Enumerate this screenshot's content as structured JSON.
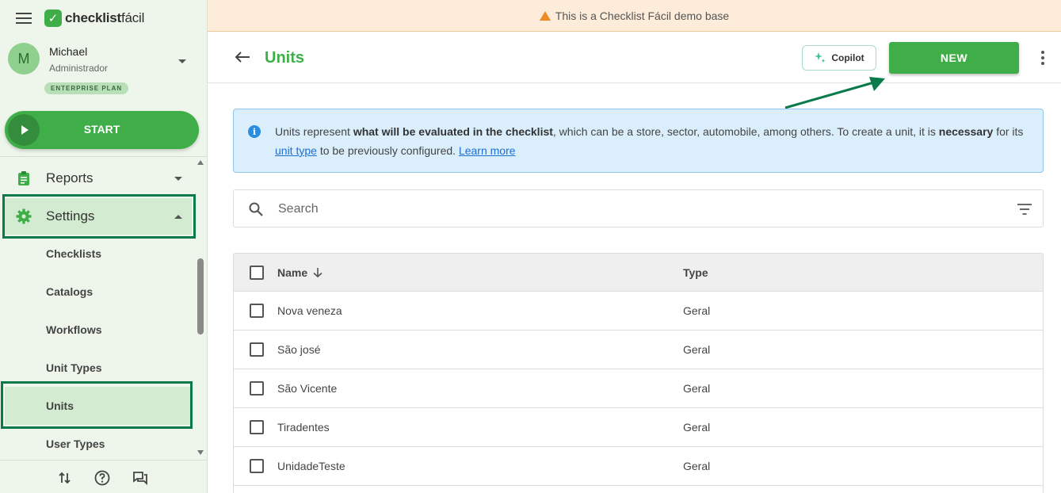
{
  "app": {
    "logo_bold": "checklist",
    "logo_light": "fácil"
  },
  "user": {
    "initial": "M",
    "name": "Michael",
    "role": "Administrador",
    "plan": "ENTERPRISE PLAN"
  },
  "sidebar": {
    "start_label": "START",
    "items": [
      {
        "label": "Reports",
        "icon": "clipboard-icon"
      },
      {
        "label": "Settings",
        "icon": "gear-icon"
      }
    ],
    "sub_items": [
      {
        "label": "Checklists"
      },
      {
        "label": "Catalogs"
      },
      {
        "label": "Workflows"
      },
      {
        "label": "Unit Types"
      },
      {
        "label": "Units"
      },
      {
        "label": "User Types"
      }
    ],
    "active_sub": "Units"
  },
  "banner": {
    "text": "This is a Checklist Fácil demo base"
  },
  "header": {
    "title": "Units",
    "copilot_label": "Copilot",
    "new_label": "NEW"
  },
  "info": {
    "part1": "Units represent ",
    "bold1": "what will be evaluated in the checklist",
    "part2": ", which can be a store, sector, automobile, among others. To create a unit, it is ",
    "bold2": "necessary",
    "part3": " for its ",
    "link1": "unit type",
    "part4": " to be previously configured. ",
    "link2": "Learn more"
  },
  "search": {
    "placeholder": "Search"
  },
  "table": {
    "columns": {
      "name": "Name",
      "type": "Type"
    },
    "rows": [
      {
        "name": "Nova veneza",
        "type": "Geral"
      },
      {
        "name": "São josé",
        "type": "Geral"
      },
      {
        "name": "São Vicente",
        "type": "Geral"
      },
      {
        "name": "Tiradentes",
        "type": "Geral"
      },
      {
        "name": "UnidadeTeste",
        "type": "Geral"
      }
    ]
  },
  "colors": {
    "brand": "#3fae49",
    "annotation": "#0b7a4b",
    "info_bg": "#dbeefc",
    "banner_bg": "#fcecd9"
  }
}
